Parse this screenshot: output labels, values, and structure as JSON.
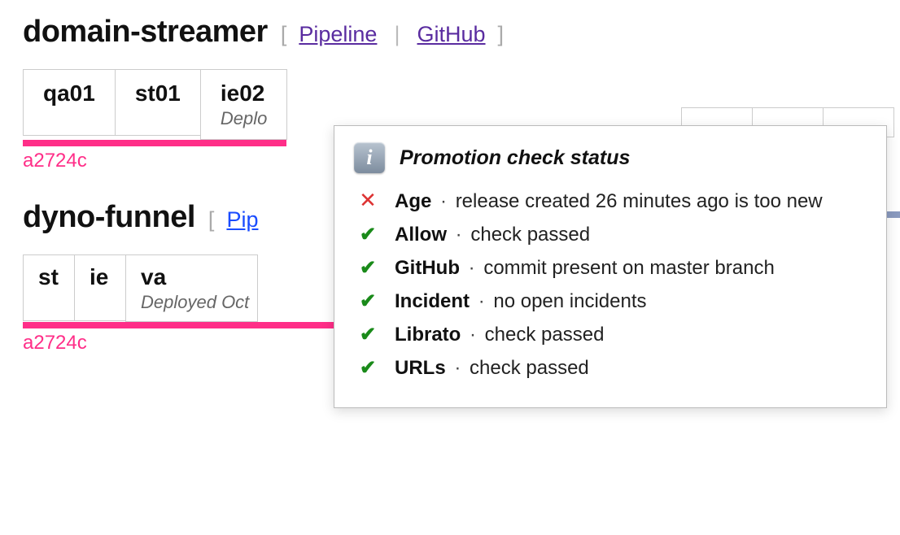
{
  "apps": [
    {
      "title": "domain-streamer",
      "links": {
        "pipeline": "Pipeline",
        "github": "GitHub",
        "link_color": "purple"
      },
      "envs": [
        {
          "name": "qa01",
          "sub": ""
        },
        {
          "name": "st01",
          "sub": ""
        },
        {
          "name": "ie02",
          "sub": "Deplo"
        }
      ],
      "commit": "a2724c"
    },
    {
      "title": "dyno-funnel",
      "links": {
        "pipeline": "Pip",
        "link_color": "blue"
      },
      "envs": [
        {
          "name": "st",
          "sub": ""
        },
        {
          "name": "ie",
          "sub": ""
        },
        {
          "name": "va",
          "sub": "Deployed Oct"
        }
      ],
      "commit": "a2724c"
    }
  ],
  "tooltip": {
    "title": "Promotion check status",
    "checks": [
      {
        "status": "fail",
        "label": "Age",
        "message": "release created 26 minutes ago is too new"
      },
      {
        "status": "pass",
        "label": "Allow",
        "message": "check passed"
      },
      {
        "status": "pass",
        "label": "GitHub",
        "message": "commit present on master branch"
      },
      {
        "status": "pass",
        "label": "Incident",
        "message": "no open incidents"
      },
      {
        "status": "pass",
        "label": "Librato",
        "message": "check passed"
      },
      {
        "status": "pass",
        "label": "URLs",
        "message": "check passed"
      }
    ]
  },
  "glyphs": {
    "pass": "✔",
    "fail": "✕",
    "info": "i",
    "dot": "·"
  },
  "brackets": {
    "open": "[",
    "close": "]",
    "sep": "|"
  }
}
